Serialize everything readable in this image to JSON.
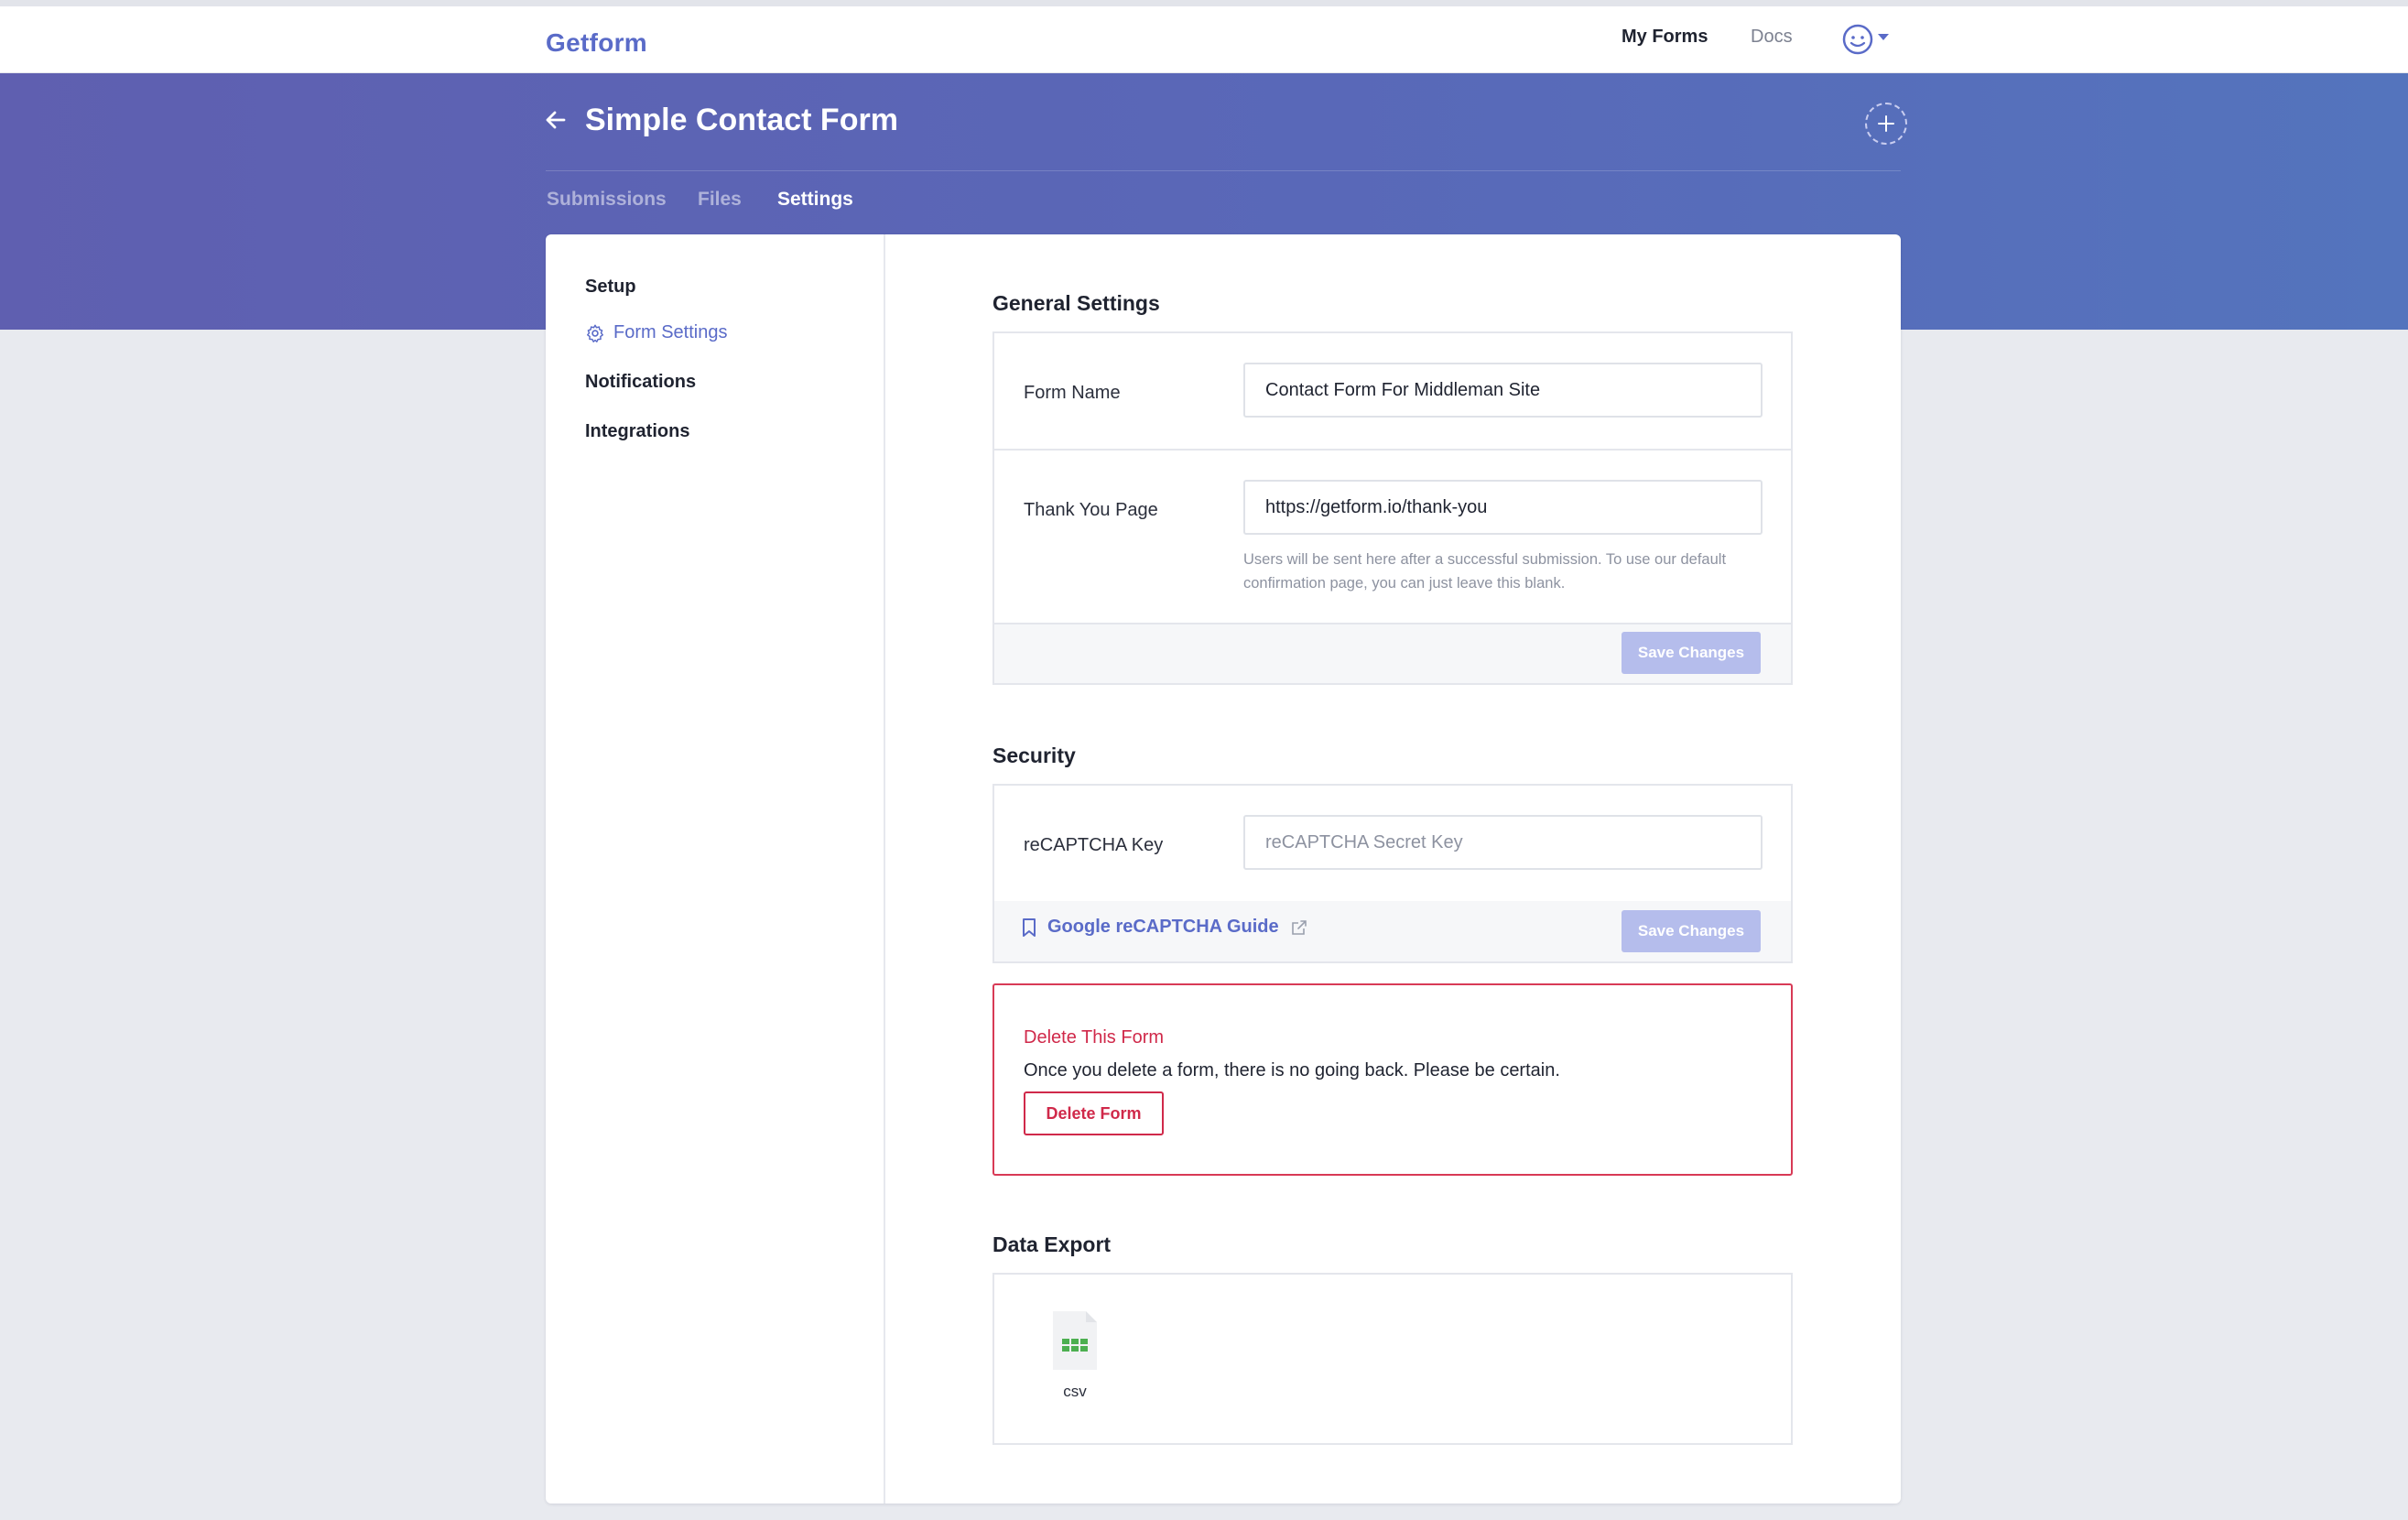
{
  "navbar": {
    "logo": "Getform",
    "my_forms": "My Forms",
    "docs": "Docs"
  },
  "header": {
    "title": "Simple Contact Form",
    "tabs": [
      "Submissions",
      "Files",
      "Settings"
    ],
    "active_tab": "Settings"
  },
  "sidebar": {
    "items": [
      {
        "label": "Setup"
      },
      {
        "label": "Form Settings",
        "icon": "gear-icon",
        "active": true
      },
      {
        "label": "Notifications"
      },
      {
        "label": "Integrations"
      }
    ]
  },
  "general": {
    "title": "General Settings",
    "form_name_label": "Form Name",
    "form_name_value": "Contact Form For Middleman Site",
    "thank_you_label": "Thank You Page",
    "thank_you_value": "https://getform.io/thank-you",
    "thank_you_help": "Users will be sent here after a successful submission. To use our default confirmation page, you can just leave this blank.",
    "save_label": "Save Changes"
  },
  "security": {
    "title": "Security",
    "recaptcha_label": "reCAPTCHA Key",
    "recaptcha_placeholder": "reCAPTCHA Secret Key",
    "recaptcha_value": "",
    "guide_label": "Google reCAPTCHA Guide",
    "save_label": "Save Changes"
  },
  "danger": {
    "title": "Delete This Form",
    "text": "Once you delete a form, there is no going back. Please be certain.",
    "button": "Delete Form"
  },
  "export": {
    "title": "Data Export",
    "csv_label": "csv"
  },
  "colors": {
    "brand": "#5a6bc8",
    "hero_start": "#5f5fb0",
    "hero_end": "#5474bd",
    "danger": "#d0294a",
    "save_disabled": "#b5bdec",
    "csv_green": "#4caf50"
  }
}
